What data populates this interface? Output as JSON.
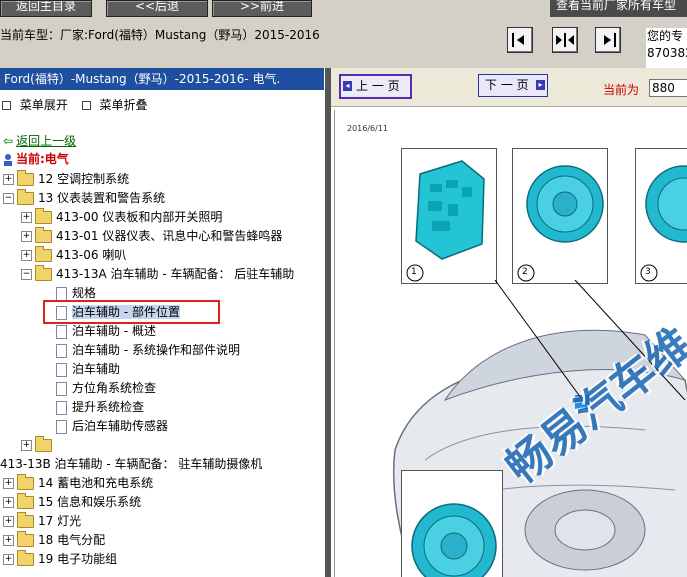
{
  "top_buttons": {
    "back_to_toc": "返回主目录",
    "prev_topic": "<<后退",
    "next_topic": ">>前进",
    "view_all": "查看当前厂家所有车型"
  },
  "vehicle_info": "当前车型：厂家:Ford(福特）Mustang（野马）2015-2016",
  "welcome": {
    "line1": "您的专",
    "line2": "870382"
  },
  "left_panel": {
    "path": "Ford(福特）-Mustang（野马）-2015-2016- 电气.",
    "expand_all": "菜单展开",
    "collapse_all": "菜单折叠",
    "back_link": "返回上一级",
    "current": "当前:电气",
    "tree": [
      "12 空调控制系统",
      "13 仪表装置和警告系统",
      "413-00 仪表板和内部开关照明",
      "413-01 仪器仪表、讯息中心和警告蜂鸣器",
      "413-06 喇叭",
      "413-13A 泊车辅助 - 车辆配备： 后驻车辅助",
      "规格",
      "泊车辅助 - 部件位置",
      "泊车辅助 - 概述",
      "泊车辅助 - 系统操作和部件说明",
      "泊车辅助",
      "方位角系统检查",
      "提升系统检查",
      "后泊车辅助传感器",
      "",
      "413-13B 泊车辅助 - 车辆配备： 驻车辅助摄像机",
      "14 蓄电池和充电系统",
      "15 信息和娱乐系统",
      "17 灯光",
      "18 电气分配",
      "19 电子功能组"
    ]
  },
  "doc_toolbar": {
    "prev_page": "上 一 页",
    "next_page": "下 一 页",
    "current_label": "当前为",
    "page_value": "880"
  },
  "document": {
    "date": "2016/6/11",
    "callouts": [
      "1",
      "2",
      "3"
    ],
    "watermark": "畅易汽车维"
  },
  "colors": {
    "path_bar": "#1f4fa0",
    "link_green": "#006400",
    "current_red": "#cc0000",
    "watermark": "#1a66b3",
    "selection_border": "#e02020"
  },
  "icons": [
    "back-arrow-icon",
    "current-location-icon",
    "collapse-left-icon",
    "split-view-icon",
    "collapse-right-icon",
    "prev-page-icon",
    "next-page-icon"
  ]
}
